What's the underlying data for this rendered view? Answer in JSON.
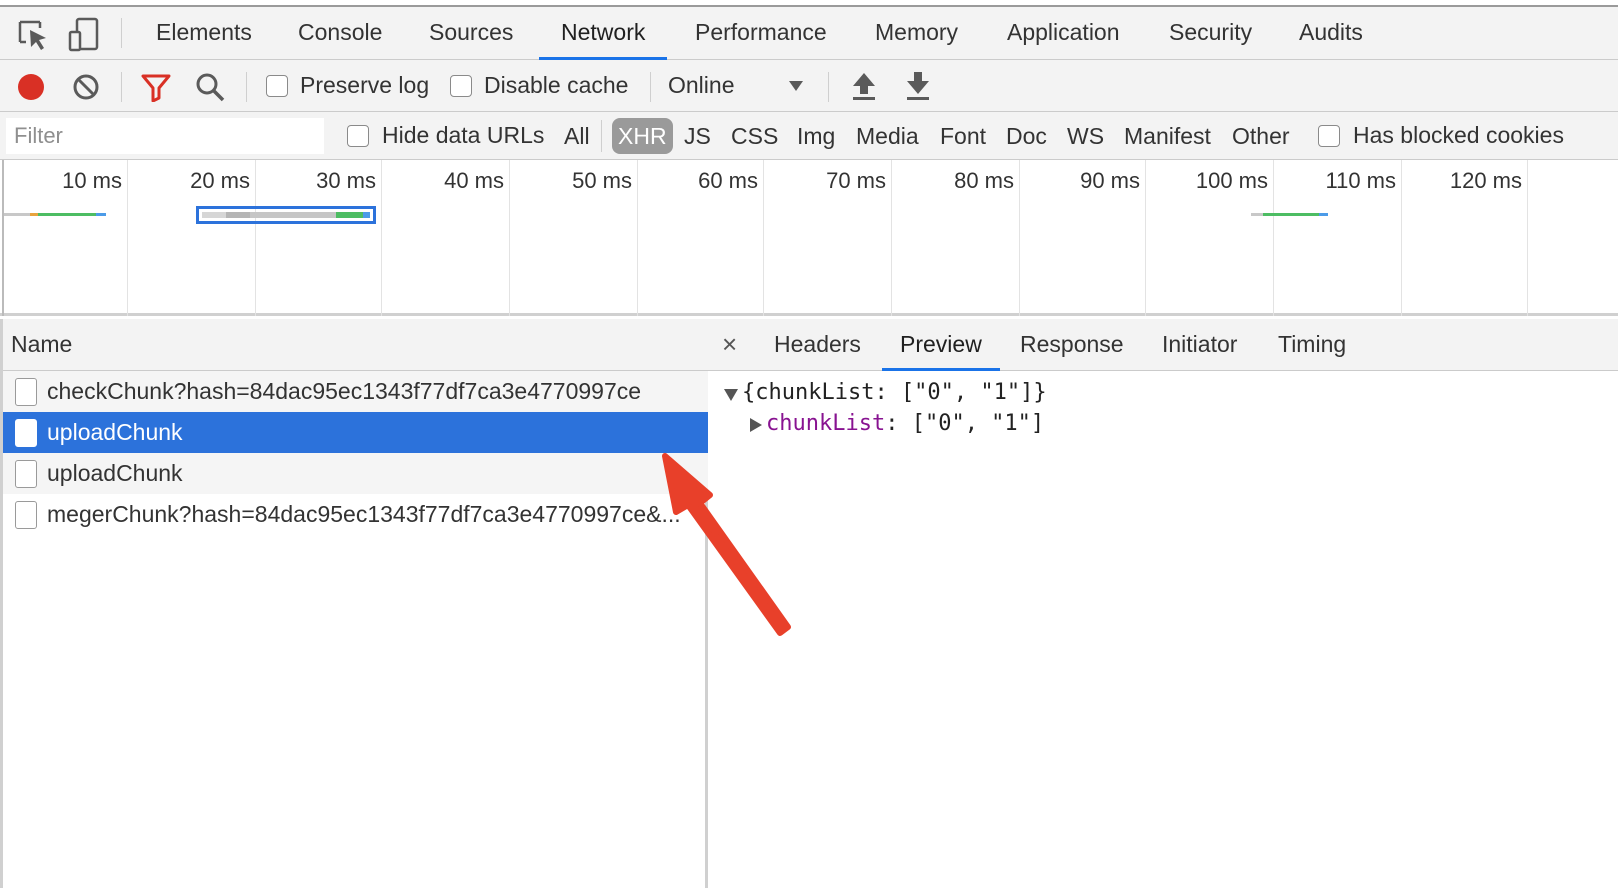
{
  "tabs": [
    "Elements",
    "Console",
    "Sources",
    "Network",
    "Performance",
    "Memory",
    "Application",
    "Security",
    "Audits"
  ],
  "active_tab": "Network",
  "toolbar": {
    "preserve_log": "Preserve log",
    "disable_cache": "Disable cache",
    "throttle": "Online"
  },
  "filter": {
    "placeholder": "Filter",
    "hide_data_urls": "Hide data URLs",
    "types": [
      "All",
      "XHR",
      "JS",
      "CSS",
      "Img",
      "Media",
      "Font",
      "Doc",
      "WS",
      "Manifest",
      "Other"
    ],
    "active_type": "XHR",
    "has_blocked_cookies": "Has blocked cookies"
  },
  "timeline": {
    "ticks": [
      "10 ms",
      "20 ms",
      "30 ms",
      "40 ms",
      "50 ms",
      "60 ms",
      "70 ms",
      "80 ms",
      "90 ms",
      "100 ms",
      "110 ms",
      "120 ms"
    ]
  },
  "requests": {
    "header": "Name",
    "rows": [
      "checkChunk?hash=84dac95ec1343f77df7ca3e4770997ce",
      "uploadChunk",
      "uploadChunk",
      "megerChunk?hash=84dac95ec1343f77df7ca3e4770997ce&..."
    ],
    "selected_index": 1
  },
  "detail": {
    "close": "×",
    "tabs": [
      "Headers",
      "Preview",
      "Response",
      "Initiator",
      "Timing"
    ],
    "active_tab": "Preview",
    "preview_summary": "{chunkList: [\"0\", \"1\"]}",
    "preview_key": "chunkList",
    "preview_value": ": [\"0\", \"1\"]"
  },
  "colors": {
    "accent": "#1a73e8",
    "selected_row": "#2c72db",
    "record": "#d93025",
    "filter_icon": "#d93025",
    "annotation_arrow": "#e8402a"
  }
}
